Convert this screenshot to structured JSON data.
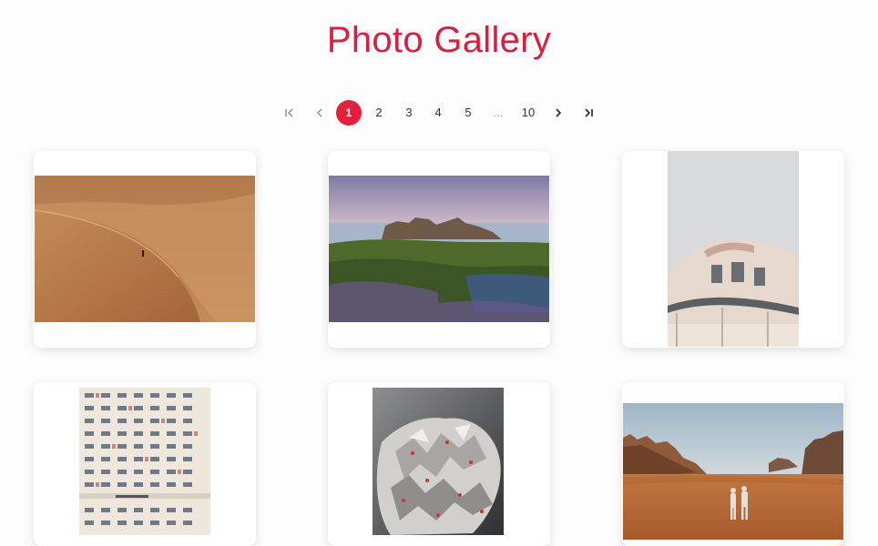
{
  "header": {
    "title": "Photo Gallery"
  },
  "pagination": {
    "first_icon": "first-page-icon",
    "prev_icon": "chevron-left-icon",
    "pages": [
      "1",
      "2",
      "3",
      "4",
      "5"
    ],
    "ellipsis": "...",
    "last_page": "10",
    "current_page": "1",
    "next_icon": "chevron-right-icon",
    "last_icon": "last-page-icon"
  },
  "colors": {
    "accent": "#e4203f",
    "title": "#d5213f"
  },
  "gallery": {
    "photos": [
      {
        "name": "desert-dune-photo"
      },
      {
        "name": "coastal-rocks-photo"
      },
      {
        "name": "building-facade-photo"
      },
      {
        "name": "parking-building-photo"
      },
      {
        "name": "abstract-sculpture-photo"
      },
      {
        "name": "desert-couple-photo"
      }
    ]
  }
}
